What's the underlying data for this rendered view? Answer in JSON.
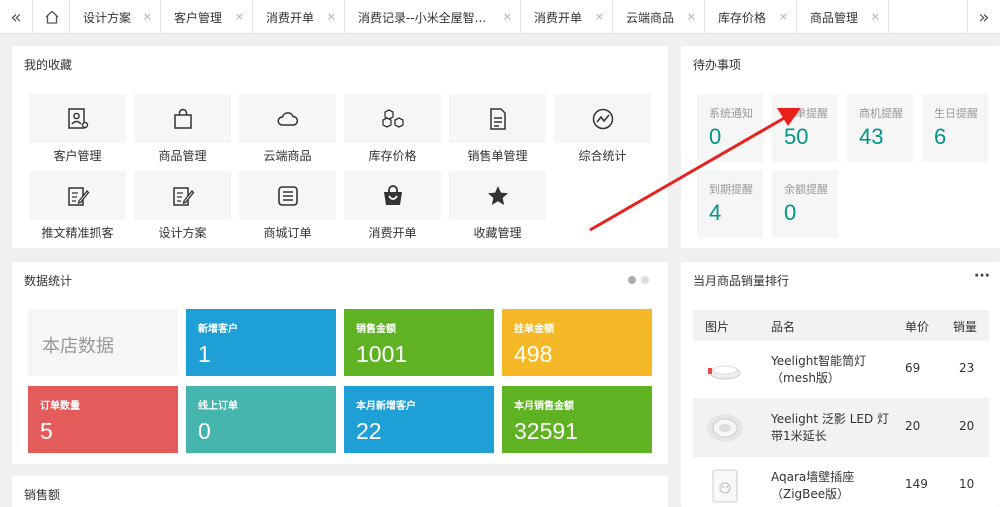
{
  "tabs": [
    {
      "label": "设计方案"
    },
    {
      "label": "客户管理"
    },
    {
      "label": "消费开单"
    },
    {
      "label": "消费记录--小米全屋智..."
    },
    {
      "label": "消费开单"
    },
    {
      "label": "云端商品"
    },
    {
      "label": "库存价格"
    },
    {
      "label": "商品管理"
    }
  ],
  "tab_close_glyph": "×",
  "favorites": {
    "title": "我的收藏",
    "items": [
      {
        "label": "客户管理",
        "icon": "customer-card-icon"
      },
      {
        "label": "商品管理",
        "icon": "shopping-bag-icon"
      },
      {
        "label": "云端商品",
        "icon": "cloud-icon"
      },
      {
        "label": "库存价格",
        "icon": "boxes-icon"
      },
      {
        "label": "销售单管理",
        "icon": "document-icon"
      },
      {
        "label": "综合统计",
        "icon": "gauge-icon"
      },
      {
        "label": "推文精准抓客",
        "icon": "edit-note-icon"
      },
      {
        "label": "设计方案",
        "icon": "edit-note-icon"
      },
      {
        "label": "商城订单",
        "icon": "order-list-icon"
      },
      {
        "label": "消费开单",
        "icon": "basket-icon"
      },
      {
        "label": "收藏管理",
        "icon": "star-icon"
      }
    ]
  },
  "todo": {
    "title": "待办事项",
    "items": [
      {
        "label": "系统通知",
        "value": "0"
      },
      {
        "label": "返单提醒",
        "value": "50"
      },
      {
        "label": "商机提醒",
        "value": "43"
      },
      {
        "label": "生日提醒",
        "value": "6"
      },
      {
        "label": "到期提醒",
        "value": "4"
      },
      {
        "label": "余额提醒",
        "value": "0"
      }
    ]
  },
  "stats": {
    "title": "数据统计",
    "store_label": "本店数据",
    "cards": [
      {
        "label": "新增客户",
        "value": "1",
        "color": "#1e9fd6"
      },
      {
        "label": "销售金额",
        "value": "1001",
        "color": "#5fb323"
      },
      {
        "label": "挂单金额",
        "value": "498",
        "color": "#f5b826"
      },
      {
        "label": "订单数量",
        "value": "5",
        "color": "#e35b5b"
      },
      {
        "label": "线上订单",
        "value": "0",
        "color": "#45b5ad"
      },
      {
        "label": "本月新增客户",
        "value": "22",
        "color": "#1e9fd6"
      },
      {
        "label": "本月销售金额",
        "value": "32591",
        "color": "#5fb323"
      }
    ]
  },
  "ranking": {
    "title": "当月商品销量排行",
    "more": "···",
    "headers": {
      "image": "图片",
      "name": "品名",
      "price": "单价",
      "qty": "销量"
    },
    "rows": [
      {
        "name": "Yeelight智能筒灯（mesh版）",
        "price": "69",
        "qty": "23"
      },
      {
        "name": "Yeelight 泛影 LED 灯带1米延长",
        "price": "20",
        "qty": "20"
      },
      {
        "name": "Aqara墙壁插座（ZigBee版）",
        "price": "149",
        "qty": "10"
      }
    ]
  },
  "sales": {
    "title": "销售额"
  },
  "colors": {
    "accent": "#009688",
    "arrow": "#e8211d"
  }
}
